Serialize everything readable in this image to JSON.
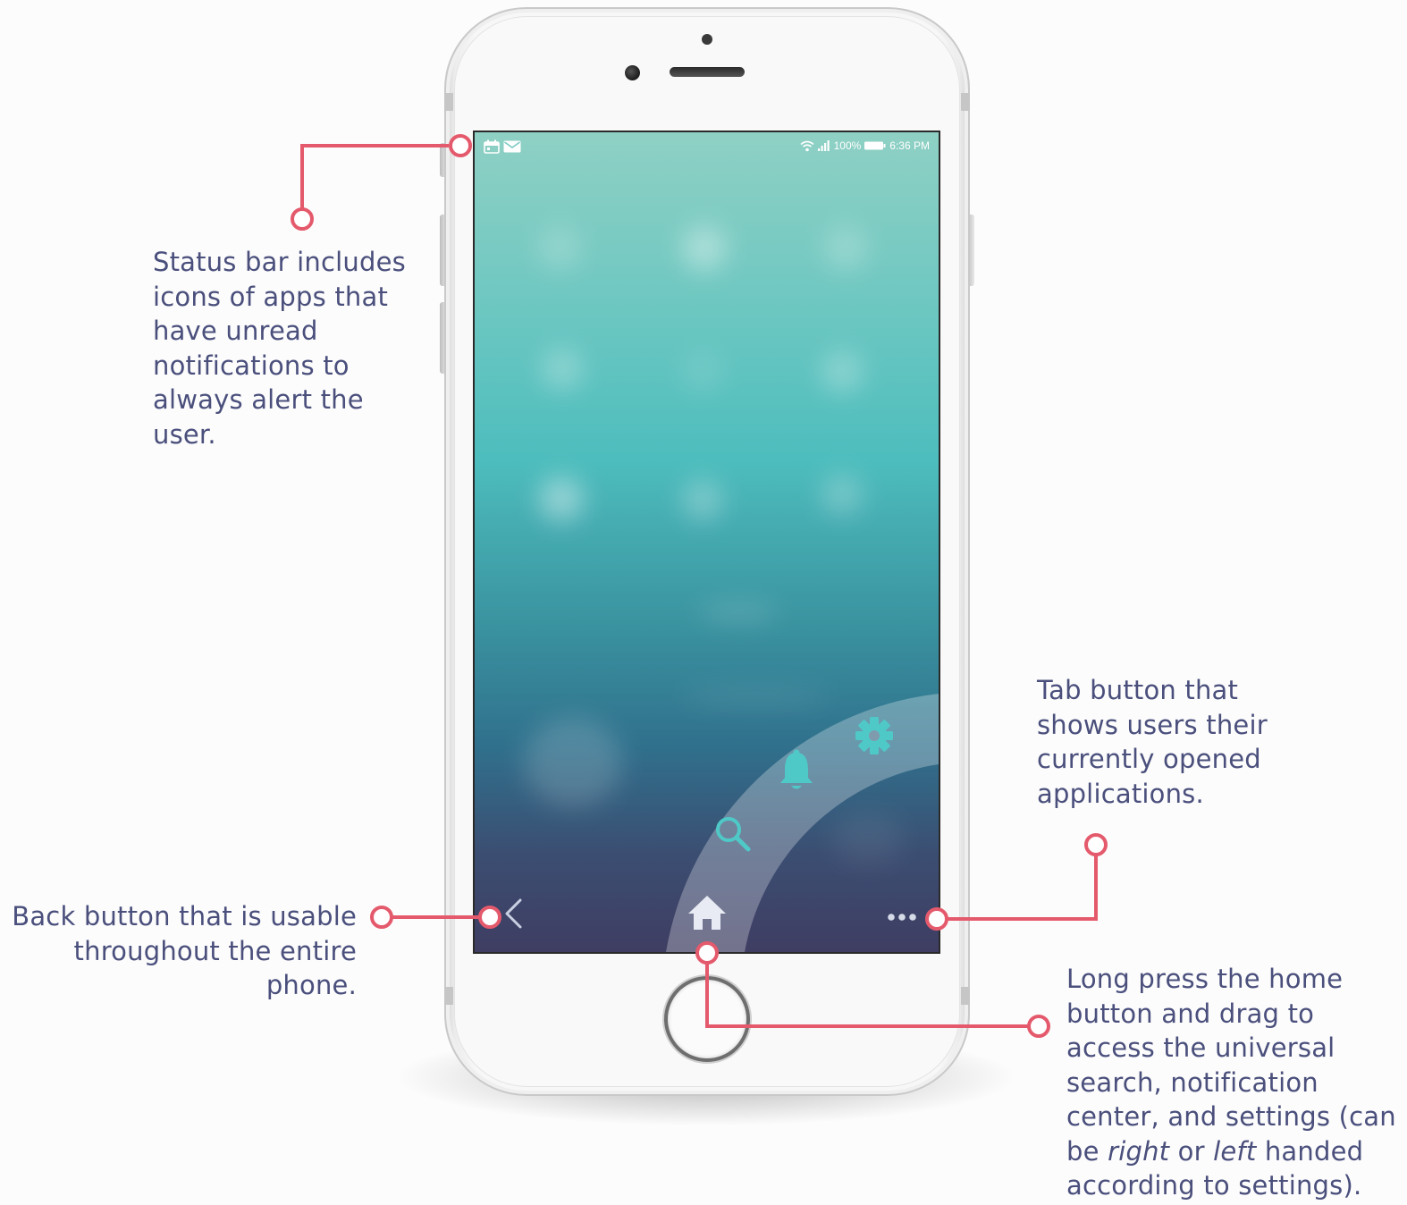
{
  "status_bar": {
    "left_icons": [
      "calendar-icon",
      "mail-icon"
    ],
    "battery": "100%",
    "time": "6:36 PM",
    "right_icons": [
      "wifi-icon",
      "signal-icon",
      "battery-icon"
    ]
  },
  "navigation": {
    "back_icon": "chevron-left-icon",
    "home_icon": "home-icon",
    "tabs_icon": "more-dots-icon"
  },
  "arc_menu": {
    "items": [
      "search-icon",
      "bell-icon",
      "gear-icon"
    ]
  },
  "annotations": {
    "status_bar": {
      "lines": [
        "Status bar includes",
        "icons of apps that",
        "have unread",
        "notifications to",
        "always alert the",
        "user."
      ]
    },
    "tab_button": {
      "lines": [
        "Tab button that",
        "shows users their",
        "currently opened",
        "applications."
      ]
    },
    "back_button": {
      "lines": [
        "Back button that is usable",
        "throughout the entire",
        "phone."
      ]
    },
    "home_button": {
      "line1": "Long press the home",
      "line2": "button and drag to",
      "line3": "access the universal",
      "line4": "search, notification",
      "line5": "center, and settings (can",
      "line6_a": "be ",
      "line6_b": "right",
      "line6_c": " or ",
      "line6_d": "left",
      "line6_e": " handed",
      "line7": "according to settings)."
    }
  },
  "colors": {
    "callout_line": "#e45a6c",
    "callout_text": "#4a4f7c",
    "accent_icon": "#4fc9c7"
  }
}
